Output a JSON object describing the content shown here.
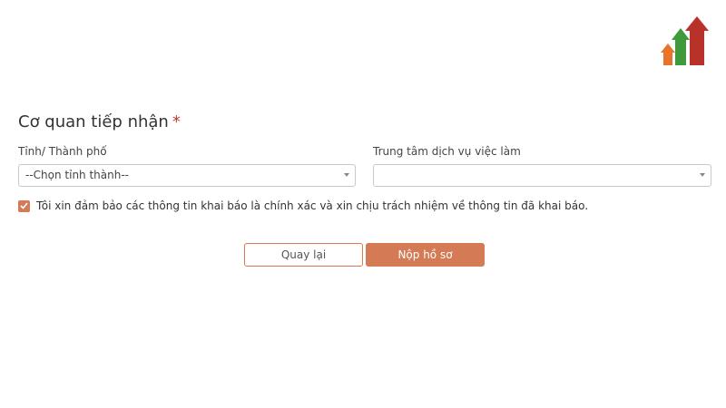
{
  "logo": {
    "icon": "rising-arrows-logo-icon",
    "colors": {
      "orange": "#e8732a",
      "green": "#3f9a3c",
      "red": "#b8322a"
    }
  },
  "form": {
    "section_title": "Cơ quan tiếp nhận",
    "required_marker": "*",
    "province": {
      "label": "Tỉnh/ Thành phố",
      "selected_value": "--Chọn tỉnh thành--"
    },
    "job_center": {
      "label": "Trung tâm dịch vụ việc làm",
      "selected_value": ""
    },
    "agreement": {
      "checked": true,
      "text": "Tôi xin đảm bảo các thông tin khai báo là chính xác và xin chịu trách nhiệm về thông tin đã khai báo."
    },
    "buttons": {
      "back_label": "Quay lại",
      "submit_label": "Nộp hồ sơ"
    }
  },
  "theme": {
    "accent": "#d47a55",
    "required": "#c0392b",
    "border": "#c9c9c9"
  }
}
